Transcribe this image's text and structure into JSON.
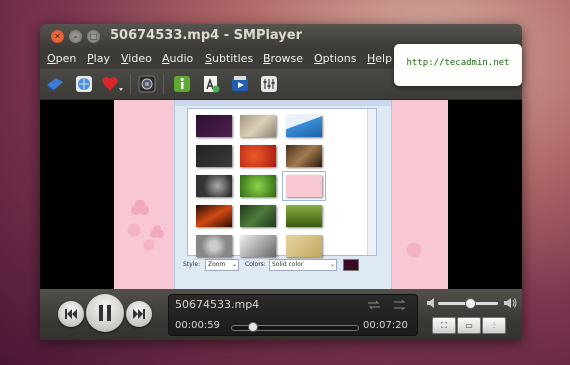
{
  "window": {
    "title": "50674533.mp4 - SMPlayer",
    "buttons": [
      "close-icon",
      "minimize-icon",
      "maximize-icon"
    ]
  },
  "menu": [
    {
      "label": "Open",
      "u": "O",
      "rest": "pen"
    },
    {
      "label": "Play",
      "u": "P",
      "rest": "lay"
    },
    {
      "label": "Video",
      "u": "V",
      "rest": "ideo"
    },
    {
      "label": "Audio",
      "u": "A",
      "rest": "udio"
    },
    {
      "label": "Subtitles",
      "u": "S",
      "rest": "ubtitles"
    },
    {
      "label": "Browse",
      "u": "B",
      "rest": "rowse"
    },
    {
      "label": "Options",
      "u": "O",
      "rest": "ptions"
    },
    {
      "label": "Help",
      "u": "H",
      "rest": "elp"
    }
  ],
  "toolbar": {
    "icons": [
      "open-file-icon",
      "open-url-icon",
      "favorites-icon",
      "screenshot-icon",
      "info-icon",
      "subtitle-icon",
      "playlist-icon",
      "equalizer-icon"
    ]
  },
  "video": {
    "dialog": {
      "style_label": "Style:",
      "style_value": "Zoom",
      "colors_label": "Colors:",
      "colors_value": "Solid color",
      "swatch_color": "#3a0a22"
    }
  },
  "controls": {
    "filename": "50674533.mp4",
    "elapsed": "00:00:59",
    "total": "00:07:20",
    "progress": 0.134,
    "volume": 0.45
  },
  "tooltip": {
    "text": "http://tecadmin.net"
  },
  "colors": {
    "accent_link": "#1e6b14",
    "window_bg": "#3c3b37",
    "video_pink": "#f7c7d4"
  }
}
